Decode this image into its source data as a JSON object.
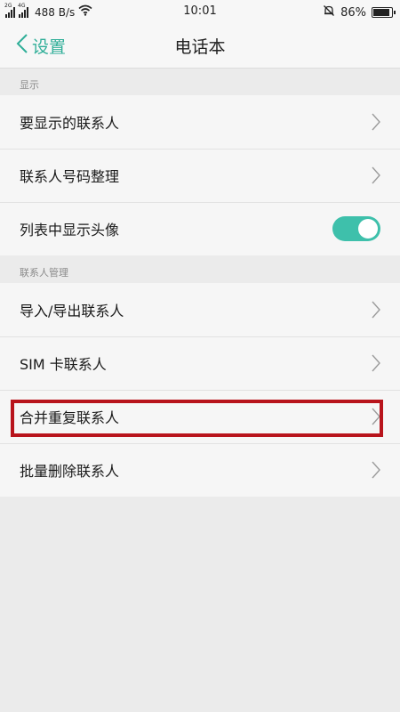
{
  "status_bar": {
    "sim1": "2G",
    "sim2": "4G",
    "net_speed": "488 B/s",
    "time": "10:01",
    "battery": "86%",
    "icons": [
      "signal-icon",
      "wifi-icon",
      "muted-bell-icon",
      "battery-icon"
    ]
  },
  "nav": {
    "back_label": "设置",
    "title": "电话本"
  },
  "sections": {
    "display": {
      "header": "显示",
      "rows": [
        "要显示的联系人",
        "联系人号码整理",
        "列表中显示头像"
      ],
      "avatar_toggle_on": true
    },
    "manage": {
      "header": "联系人管理",
      "rows": [
        "导入/导出联系人",
        "SIM 卡联系人",
        "合并重复联系人",
        "批量删除联系人"
      ]
    }
  },
  "colors": {
    "accent": "#2fae98",
    "toggle_on": "#3ec0ab",
    "highlight": "#b8141c"
  }
}
